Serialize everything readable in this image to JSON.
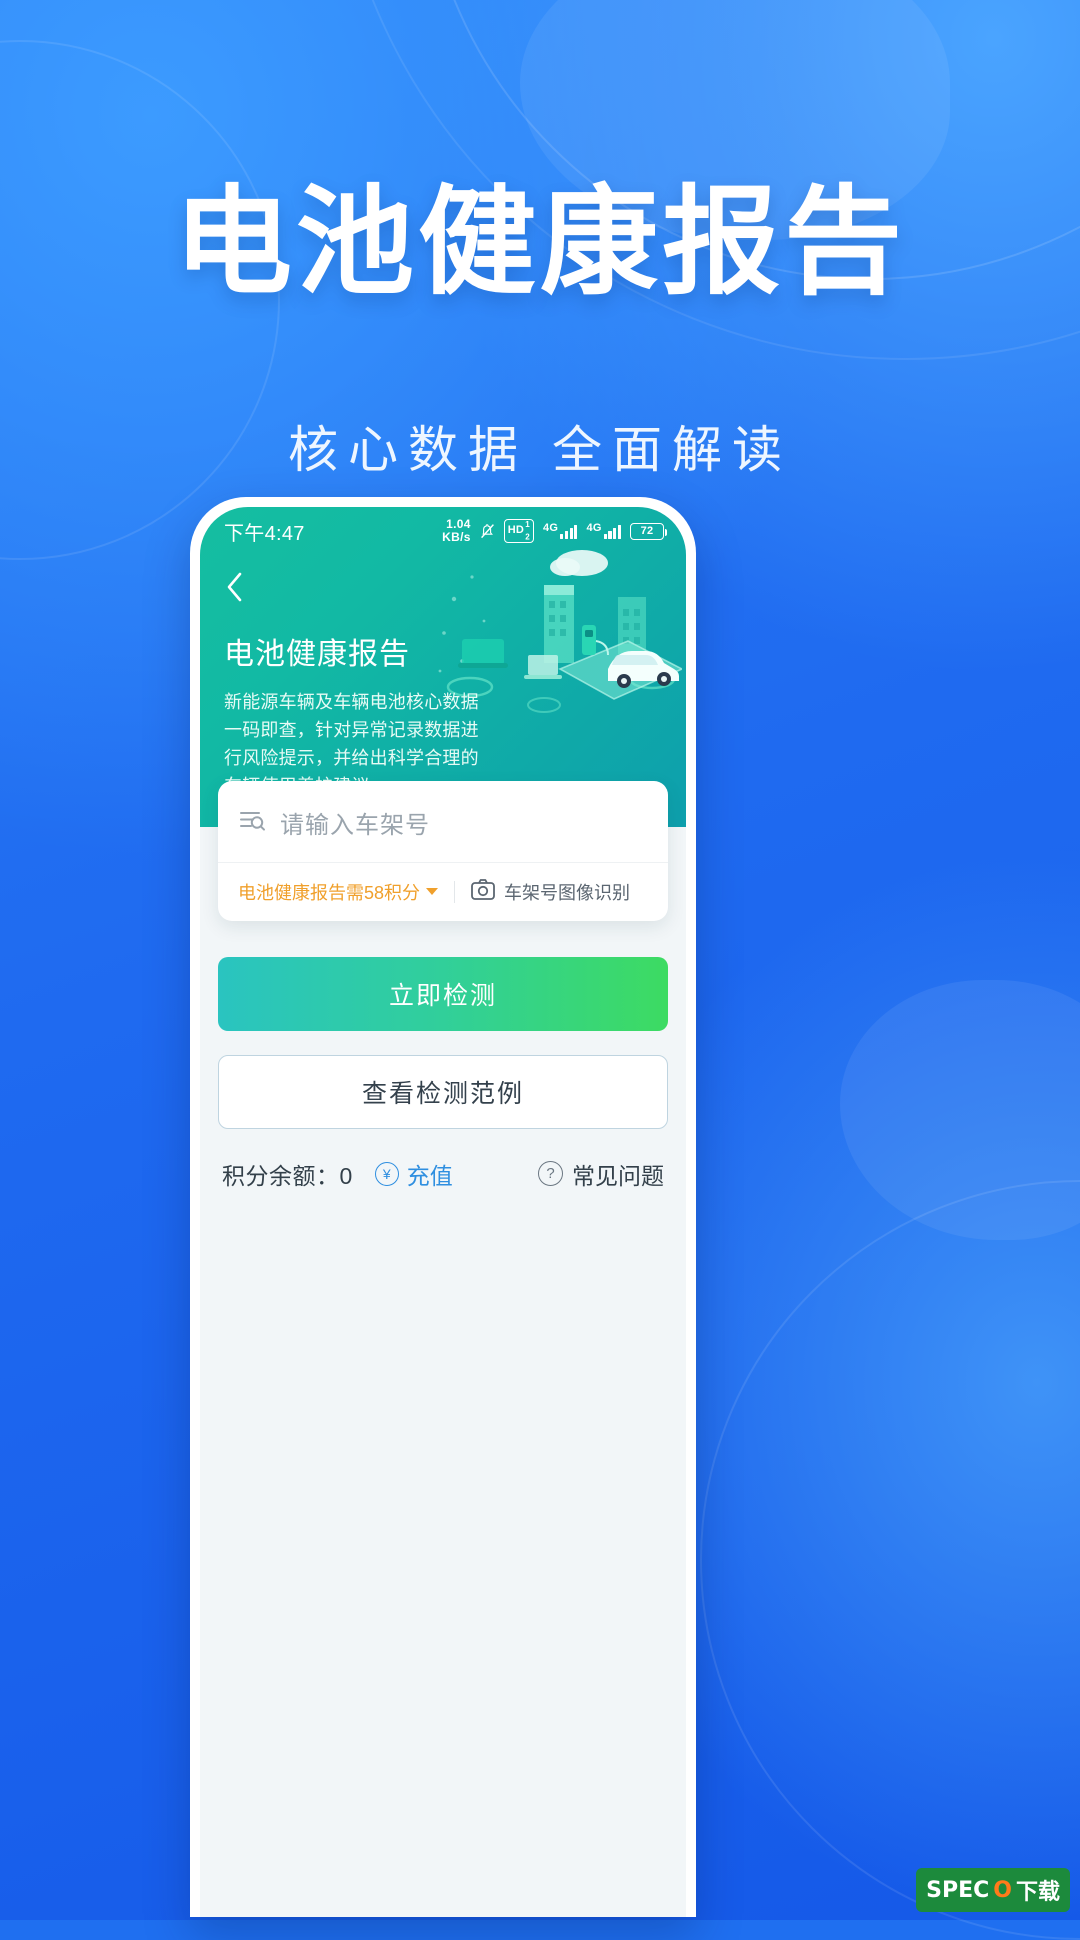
{
  "promo": {
    "headline": "电池健康报告",
    "subline": "核心数据 全面解读",
    "bg_color": "#1f6ff0",
    "title_color": "#ffffff"
  },
  "phone": {
    "status_bar": {
      "time": "下午4:47",
      "net_speed_value": "1.04",
      "net_speed_unit": "KB/s",
      "mute_icon": "bell-slash-icon",
      "hd_label": "HD",
      "hd_sup": "1",
      "hd_sub": "2",
      "sim1_network": "4G",
      "sim2_network": "4G",
      "battery_level": "72"
    },
    "hero": {
      "back_icon": "chevron-left-icon",
      "title": "电池健康报告",
      "description": "新能源车辆及车辆电池核心数据一码即查，针对异常记录数据进行风险提示，并给出科学合理的车辆使用养护建议。",
      "gradient_from": "#16bfa0",
      "gradient_to": "#0e9fad"
    },
    "search_card": {
      "vin_icon": "search-list-icon",
      "vin_value": "",
      "vin_placeholder": "请输入车架号",
      "points_label": "电池健康报告需58积分",
      "points_color": "#f0a02c",
      "points_dropdown_icon": "caret-down-icon",
      "ocr_icon": "camera-icon",
      "ocr_label": "车架号图像识别"
    },
    "actions": {
      "primary_label": "立即检测",
      "secondary_label": "查看检测范例"
    },
    "footer": {
      "balance_label": "积分余额：0",
      "recharge_icon": "coin-icon",
      "recharge_label": "充值",
      "faq_icon": "question-circle-icon",
      "faq_label": "常见问题"
    }
  },
  "watermark": {
    "text_a": "SPEC",
    "text_o": "O",
    "text_b": "下载"
  }
}
